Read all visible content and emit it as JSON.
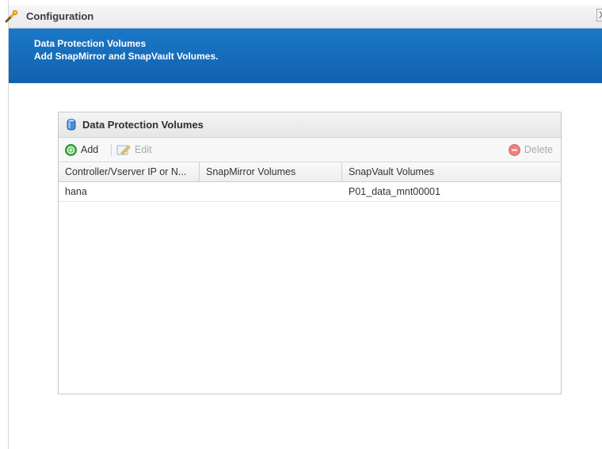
{
  "window": {
    "title": "Configuration",
    "close_label": "X"
  },
  "banner": {
    "line1": "Data Protection Volumes",
    "line2": "Add SnapMirror and SnapVault Volumes.",
    "color": "#1a6fbd"
  },
  "panel": {
    "title": "Data Protection Volumes",
    "icon": "database-icon"
  },
  "toolbar": {
    "add_label": "Add",
    "add_icon": "add-icon",
    "edit_label": "Edit",
    "edit_icon": "edit-icon",
    "edit_enabled": false,
    "delete_label": "Delete",
    "delete_icon": "delete-icon",
    "delete_enabled": false
  },
  "table": {
    "columns": [
      "Controller/Vserver IP or N...",
      "SnapMirror Volumes",
      "SnapVault Volumes"
    ],
    "rows": [
      [
        "hana",
        "",
        "P01_data_mnt00001"
      ]
    ]
  }
}
